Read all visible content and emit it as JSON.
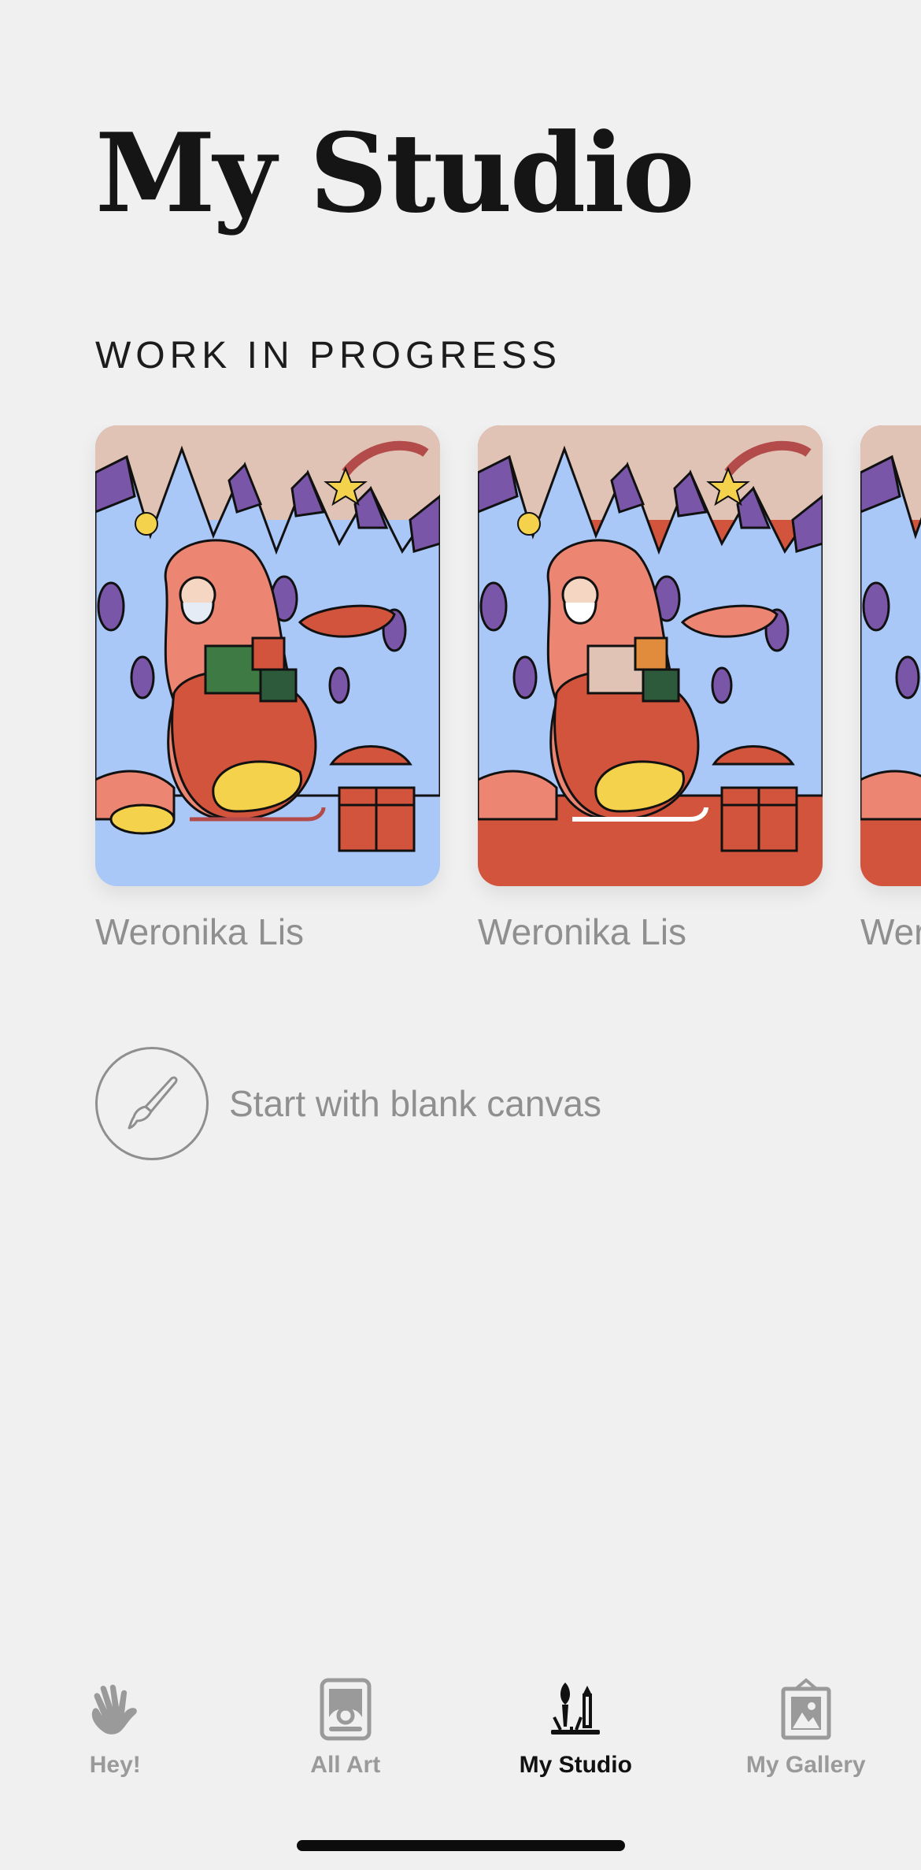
{
  "page": {
    "title": "My Studio"
  },
  "work_in_progress": {
    "section_title": "WORK IN PROGRESS",
    "items": [
      {
        "author": "Weronika Lis",
        "background": "#a9c8f8"
      },
      {
        "author": "Weronika Lis",
        "background": "#d2543c"
      },
      {
        "author": "Weronika Lis",
        "background": "#d2543c"
      }
    ]
  },
  "blank_canvas": {
    "label": "Start with blank canvas",
    "icon": "paintbrush-icon"
  },
  "tabbar": {
    "tabs": [
      {
        "label": "Hey!",
        "icon": "waving-hand-icon",
        "active": false
      },
      {
        "label": "All Art",
        "icon": "framed-picture-icon",
        "active": false
      },
      {
        "label": "My Studio",
        "icon": "brushes-icon",
        "active": true
      },
      {
        "label": "My Gallery",
        "icon": "hanging-frame-icon",
        "active": false
      }
    ]
  },
  "colors": {
    "background": "#f0f0f0",
    "text_primary": "#151515",
    "text_secondary": "#8f8f8f",
    "tab_inactive": "#9a9a9a",
    "tab_active": "#111111"
  }
}
